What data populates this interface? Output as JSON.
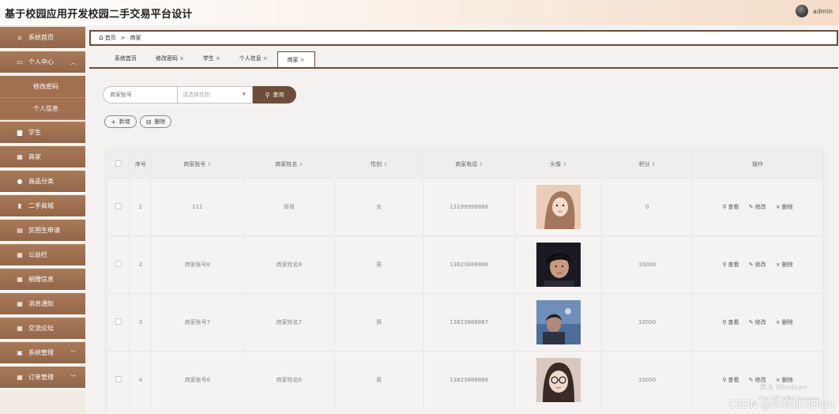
{
  "header": {
    "title": "基于校园应用开发校园二手交易平台设计",
    "username": "admin"
  },
  "sidebar": {
    "items": [
      {
        "label": "系统首页",
        "icon": "home-icon"
      },
      {
        "label": "个人中心",
        "icon": "monitor-icon",
        "expanded": true,
        "children": [
          "修改密码",
          "个人信息"
        ]
      },
      {
        "label": "学生",
        "icon": "briefcase-icon"
      },
      {
        "label": "商家",
        "icon": "grid-icon"
      },
      {
        "label": "商品分类",
        "icon": "user-icon"
      },
      {
        "label": "二手商城",
        "icon": "chart-icon"
      },
      {
        "label": "贫困生申请",
        "icon": "file-icon"
      },
      {
        "label": "公益栏",
        "icon": "grid-icon"
      },
      {
        "label": "捐赠信息",
        "icon": "table-icon"
      },
      {
        "label": "消息通知",
        "icon": "grid-icon"
      },
      {
        "label": "交流论坛",
        "icon": "grid-icon"
      },
      {
        "label": "系统管理",
        "icon": "checkbox-icon",
        "has_children": true
      },
      {
        "label": "订单管理",
        "icon": "grid-icon",
        "has_children": true
      }
    ]
  },
  "breadcrumb": {
    "home": "首页",
    "separator": ">",
    "current": "商家"
  },
  "tabs": [
    {
      "label": "系统首页",
      "closable": false
    },
    {
      "label": "修改密码",
      "closable": true
    },
    {
      "label": "学生",
      "closable": true
    },
    {
      "label": "个人信息",
      "closable": true
    },
    {
      "label": "商家",
      "closable": true,
      "active": true
    }
  ],
  "search": {
    "account_placeholder": "商家账号",
    "gender_placeholder": "请选择性别",
    "query_label": "查询"
  },
  "actions": {
    "add_label": "新增",
    "delete_label": "删除"
  },
  "table": {
    "columns": [
      "序号",
      "商家账号",
      "商家姓名",
      "性别",
      "商家电话",
      "头像",
      "积分",
      "操作"
    ],
    "ops": {
      "view": "查看",
      "edit": "修改",
      "delete": "删除"
    },
    "rows": [
      {
        "index": "1",
        "account": "111",
        "name": "哥哥",
        "gender": "女",
        "phone": "13199999888",
        "points": "0"
      },
      {
        "index": "2",
        "account": "商家账号8",
        "name": "商家姓名8",
        "gender": "男",
        "phone": "13823888888",
        "points": "10000"
      },
      {
        "index": "3",
        "account": "商家账号7",
        "name": "商家姓名7",
        "gender": "男",
        "phone": "13823888887",
        "points": "10000"
      },
      {
        "index": "4",
        "account": "商家账号6",
        "name": "商家姓名6",
        "gender": "男",
        "phone": "13823888886",
        "points": "10000"
      }
    ]
  },
  "watermark": {
    "line1": "激活 Windows",
    "line2": "转到\"设置\"以激活 Windows。",
    "csdn": "CSDN @计算机YiDian"
  },
  "colors": {
    "accent": "#6b4d3a",
    "sidebar": "#9a6d4e"
  }
}
